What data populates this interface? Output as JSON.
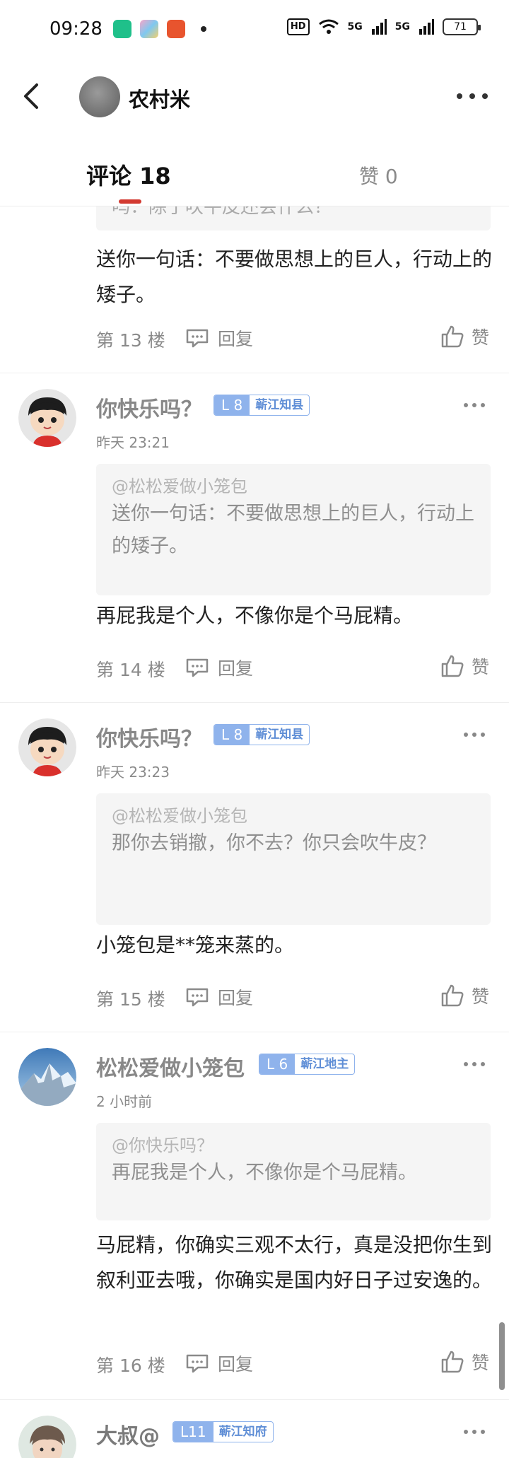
{
  "status_bar": {
    "time": "09:28",
    "hd": "HD",
    "net1": "5G",
    "net2": "5G",
    "battery": "71"
  },
  "header": {
    "title": "农村米"
  },
  "tabs": {
    "comments": "评论 18",
    "likes": "赞 0"
  },
  "clipped_quote": "吗：除了吹牛皮还会什么？",
  "comments": [
    {
      "body": "送你一句话：不要做思想上的巨人，行动上的矮子。",
      "floor": "第 13 楼",
      "reply": "回复",
      "like": "赞"
    },
    {
      "name": "你快乐吗？",
      "level": "L 8",
      "title": "蕲江知县",
      "time": "昨天 23:21",
      "quote_mention": "@松松爱做小笼包",
      "quote_text": "送你一句话：不要做思想上的巨人，行动上的矮子。",
      "body": "再屁我是个人，不像你是个马屁精。",
      "floor": "第 14 楼",
      "reply": "回复",
      "like": "赞"
    },
    {
      "name": "你快乐吗？",
      "level": "L 8",
      "title": "蕲江知县",
      "time": "昨天 23:23",
      "quote_mention": "@松松爱做小笼包",
      "quote_text": "那你去销撤，你不去？你只会吹牛皮？",
      "body": "小笼包是**笼来蒸的。",
      "floor": "第 15 楼",
      "reply": "回复",
      "like": "赞"
    },
    {
      "name": "松松爱做小笼包",
      "level": "L 6",
      "title": "蕲江地主",
      "time": "2 小时前",
      "quote_mention": "@你快乐吗？",
      "quote_text": "再屁我是个人，不像你是个马屁精。",
      "body": "马屁精，你确实三观不太行，真是没把你生到叙利亚去哦，你确实是国内好日子过安逸的。",
      "floor": "第 16 楼",
      "reply": "回复",
      "like": "赞"
    },
    {
      "name": "大叔@",
      "level": "L11",
      "title": "蕲江知府"
    }
  ],
  "colors": {
    "accent_red": "#d33a31",
    "level_blue": "#8fb3ec",
    "muted_text": "#8a8a8a"
  }
}
